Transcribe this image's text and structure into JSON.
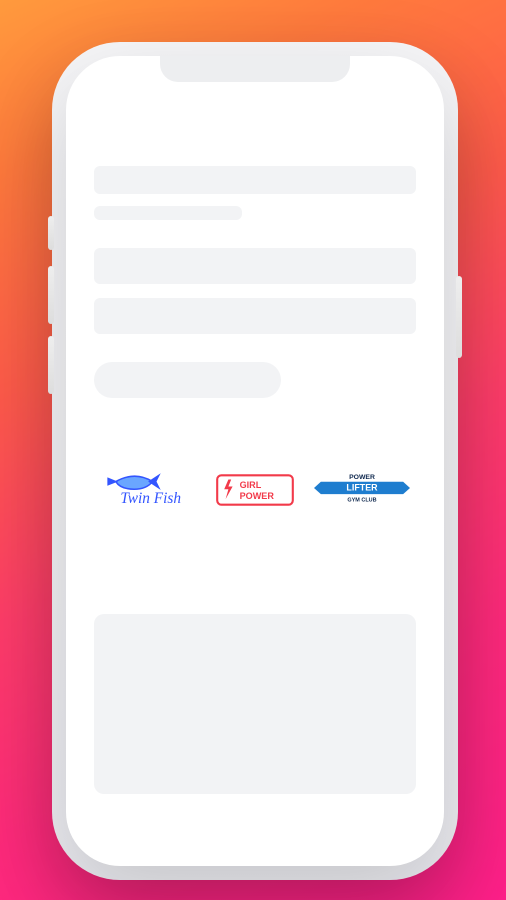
{
  "placeholders": {
    "title": "",
    "subtitle": "",
    "field1": "",
    "field2": "",
    "button": ""
  },
  "brands": [
    {
      "id": "twin-fish",
      "name": "Twin Fish",
      "text1": "Twin Fish",
      "color": "#3355ff"
    },
    {
      "id": "girl-power",
      "name": "Girl Power",
      "text1": "GIRL",
      "text2": "POWER",
      "color": "#f23a4a"
    },
    {
      "id": "power-lifter",
      "name": "Power Lifter",
      "text1": "POWER",
      "text2": "LIFTER",
      "text3": "GYM CLUB",
      "color": "#1e7dcf"
    }
  ]
}
